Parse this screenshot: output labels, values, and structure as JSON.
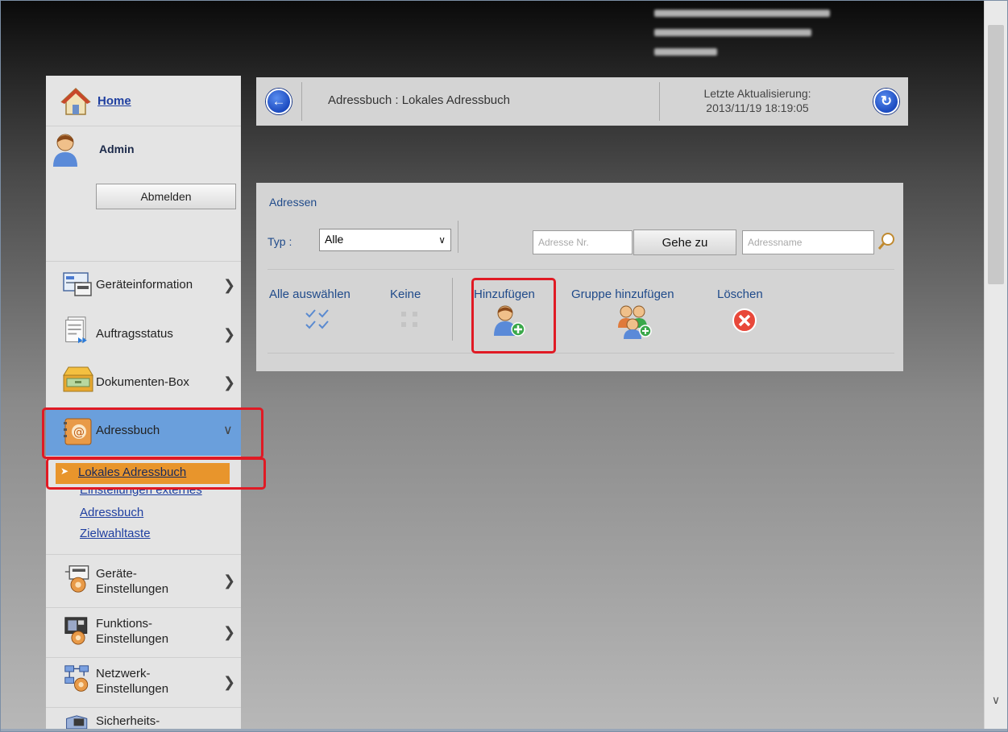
{
  "sidebar": {
    "home_label": "Home",
    "user_label": "Admin",
    "logout_label": "Abmelden",
    "items": [
      {
        "label": "Geräteinformation"
      },
      {
        "label": "Auftragsstatus"
      },
      {
        "label": "Dokumenten-Box"
      },
      {
        "label": "Adressbuch"
      },
      {
        "label": "Geräte-",
        "label2": "Einstellungen"
      },
      {
        "label": "Funktions-",
        "label2": "Einstellungen"
      },
      {
        "label": "Netzwerk-",
        "label2": "Einstellungen"
      },
      {
        "label": "Sicherheits-"
      }
    ],
    "subitems": [
      {
        "label": "Lokales Adressbuch"
      },
      {
        "label": "Einstellungen externes"
      },
      {
        "label": "Adressbuch"
      },
      {
        "label": "Zielwahltaste"
      }
    ]
  },
  "header": {
    "title": "Adressbuch : Lokales Adressbuch",
    "update_label": "Letzte Aktualisierung:",
    "update_time": "2013/11/19 18:19:05",
    "back_icon": "arrow-left-icon",
    "refresh_icon": "refresh-icon"
  },
  "panel": {
    "title": "Adressen",
    "type_label": "Typ :",
    "type_value": "Alle",
    "address_no_placeholder": "Adresse Nr.",
    "goto_label": "Gehe zu",
    "address_name_placeholder": "Adressname",
    "actions": {
      "select_all": "Alle auswählen",
      "none": "Keine",
      "add": "Hinzufügen",
      "add_group": "Gruppe hinzufügen",
      "delete": "Löschen"
    }
  },
  "colors": {
    "highlight": "#e01a24",
    "active_menu": "#6a9fdc",
    "active_submenu": "#e8952c",
    "link": "#1f3fa0"
  }
}
